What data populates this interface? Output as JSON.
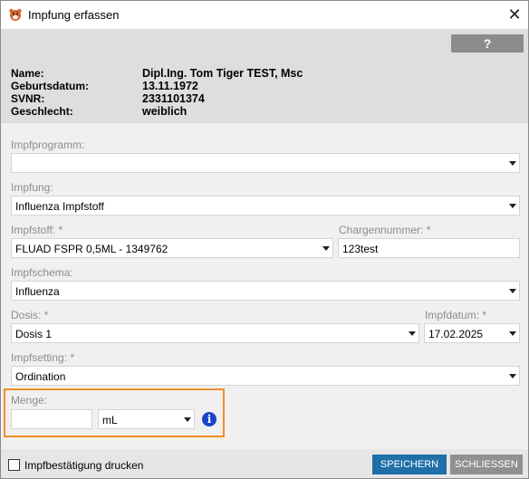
{
  "window": {
    "title": "Impfung erfassen",
    "close_glyph": "✕",
    "help_label": "?"
  },
  "patient": {
    "name_label": "Name:",
    "name_value": "Dipl.Ing. Tom Tiger TEST, Msc",
    "dob_label": "Geburtsdatum:",
    "dob_value": "13.11.1972",
    "svnr_label": "SVNR:",
    "svnr_value": "2331101374",
    "gender_label": "Geschlecht:",
    "gender_value": "weiblich"
  },
  "form": {
    "impfprogramm": {
      "label": "Impfprogramm:",
      "value": ""
    },
    "impfung": {
      "label": "Impfung:",
      "value": "Influenza Impfstoff"
    },
    "impfstoff": {
      "label": "Impfstoff: *",
      "value": "FLUAD FSPR 0,5ML - 1349762"
    },
    "chargennummer": {
      "label": "Chargennummer: *",
      "value": "123test"
    },
    "impfschema": {
      "label": "Impfschema:",
      "value": "Influenza"
    },
    "dosis": {
      "label": "Dosis: *",
      "value": "Dosis 1"
    },
    "impfdatum": {
      "label": "Impfdatum: *",
      "value": "17.02.2025"
    },
    "impfsetting": {
      "label": "Impfsetting: *",
      "value": "Ordination"
    },
    "menge": {
      "label": "Menge:",
      "value": "",
      "unit": "mL"
    }
  },
  "footer": {
    "print_label": "Impfbestätigung drucken",
    "print_checked": false,
    "save_label": "SPEICHERN",
    "close_label": "SCHLIESSEN"
  },
  "colors": {
    "highlight": "#f28c28",
    "primary_button": "#1f6fa8",
    "secondary_button": "#909090",
    "info_icon": "#1a44c8"
  },
  "icons": {
    "app": "tiger-head-icon",
    "info": "info-icon",
    "dropdown": "chevron-down-icon"
  }
}
